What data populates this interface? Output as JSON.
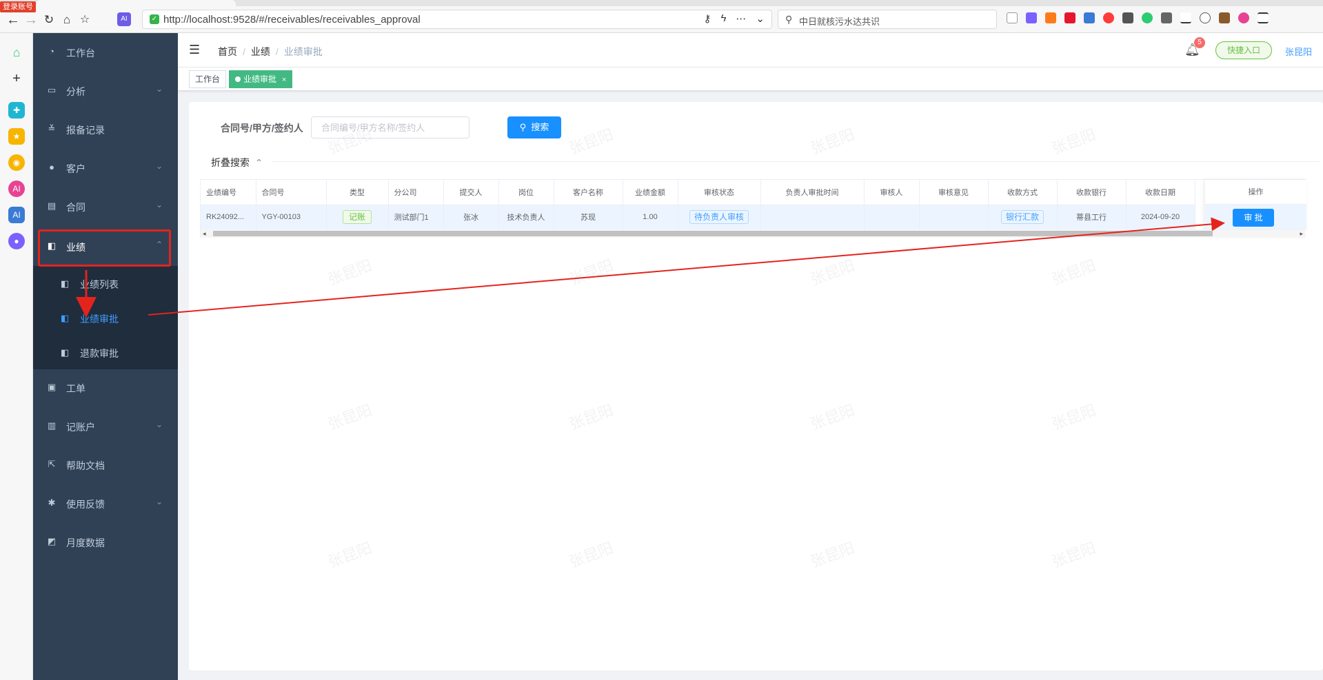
{
  "browser": {
    "login_badge": "登录账号",
    "url": "http://localhost:9528/#/receivables/receivables_approval",
    "search_text": "中日就核污水达共识"
  },
  "sidebar": {
    "items": [
      {
        "label": "工作台",
        "icon": "dashboard-icon"
      },
      {
        "label": "分析",
        "icon": "presentation-icon",
        "has_children": true
      },
      {
        "label": "报备记录",
        "icon": "checklist-icon"
      },
      {
        "label": "客户",
        "icon": "user-icon",
        "has_children": true
      },
      {
        "label": "合同",
        "icon": "document-icon",
        "has_children": true
      },
      {
        "label": "业绩",
        "icon": "wallet-icon",
        "has_children": true,
        "expanded": true
      },
      {
        "label": "工单",
        "icon": "clipboard-icon"
      },
      {
        "label": "记账户",
        "icon": "book-icon",
        "has_children": true
      },
      {
        "label": "帮助文档",
        "icon": "external-link-icon"
      },
      {
        "label": "使用反馈",
        "icon": "bug-icon",
        "has_children": true
      },
      {
        "label": "月度数据",
        "icon": "chart-icon"
      }
    ],
    "sub_items": [
      {
        "label": "业绩列表",
        "icon": "wallet-icon"
      },
      {
        "label": "业绩审批",
        "icon": "wallet-icon",
        "active": true
      },
      {
        "label": "退款审批",
        "icon": "wallet-icon"
      }
    ]
  },
  "header": {
    "breadcrumb": [
      "首页",
      "业绩",
      "业绩审批"
    ],
    "notification_count": "5",
    "quick_entry": "快捷入口",
    "user_name": "张昆阳"
  },
  "tags": {
    "items": [
      "工作台",
      "业绩审批"
    ],
    "close_symbol": "×"
  },
  "filter": {
    "label": "合同号/甲方/签约人",
    "placeholder": "合同编号/甲方名称/签约人",
    "search_button": "搜索",
    "collapse_label": "折叠搜索"
  },
  "table": {
    "columns": [
      "业绩编号",
      "合同号",
      "类型",
      "分公司",
      "提交人",
      "岗位",
      "客户名称",
      "业绩金额",
      "审核状态",
      "负责人审批时间",
      "审核人",
      "审核意见",
      "收款方式",
      "收款银行",
      "收款日期"
    ],
    "operation_header": "操作",
    "rows": [
      {
        "code": "RK24092...",
        "contract": "YGY-00103",
        "type": "记账",
        "branch": "测试部门1",
        "submitter": "张冰",
        "position": "技术负责人",
        "customer": "苏现",
        "amount": "1.00",
        "status": "待负责人审核",
        "approve_time": "",
        "auditor": "",
        "opinion": "",
        "pay_method": "银行汇款",
        "bank": "蒂县工行",
        "pay_date": "2024-09-20",
        "action": "审 批"
      }
    ]
  },
  "watermark": "张昆阳",
  "colors": {
    "sidebar_bg": "#304156",
    "submenu_bg": "#1f2d3d",
    "primary": "#1890ff",
    "active_tag": "#42b983",
    "annotation_red": "#e5231d"
  }
}
